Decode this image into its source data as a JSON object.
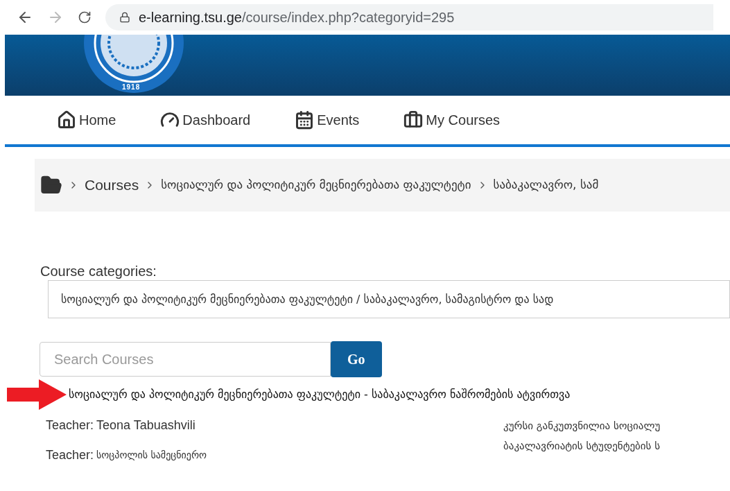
{
  "browser": {
    "url_host": "e-learning.tsu.ge",
    "url_path": "/course/index.php?categoryid=295"
  },
  "logo": {
    "year": "1918"
  },
  "nav": [
    {
      "label": "Home"
    },
    {
      "label": "Dashboard"
    },
    {
      "label": "Events"
    },
    {
      "label": "My Courses"
    }
  ],
  "breadcrumb": [
    "Courses",
    "სოციალურ და პოლიტიკურ მეცნიერებათა ფაკულტეტი",
    "საბაკალავრო, სამ"
  ],
  "categories": {
    "label": "Course categories:",
    "value": "სოციალურ და პოლიტიკურ მეცნიერებათა ფაკულტეტი / საბაკალავრო, სამაგისტრო და სად"
  },
  "search": {
    "placeholder": "Search Courses",
    "button": "Go"
  },
  "course": {
    "title": "სოციალურ და პოლიტიკურ მეცნიერებათა ფაკულტეტი - საბაკალავრო ნაშრომების ატვირთვა",
    "teachers": [
      {
        "label": "Teacher:",
        "name": "Teona Tabuashvili"
      },
      {
        "label": "Teacher:",
        "name": "სოცპოლის სამეცნიერო"
      }
    ],
    "summary": [
      "კურსი განკუთვნილია სოციალუ",
      "ბაკალავრიატის სტუდენტების ს"
    ]
  }
}
